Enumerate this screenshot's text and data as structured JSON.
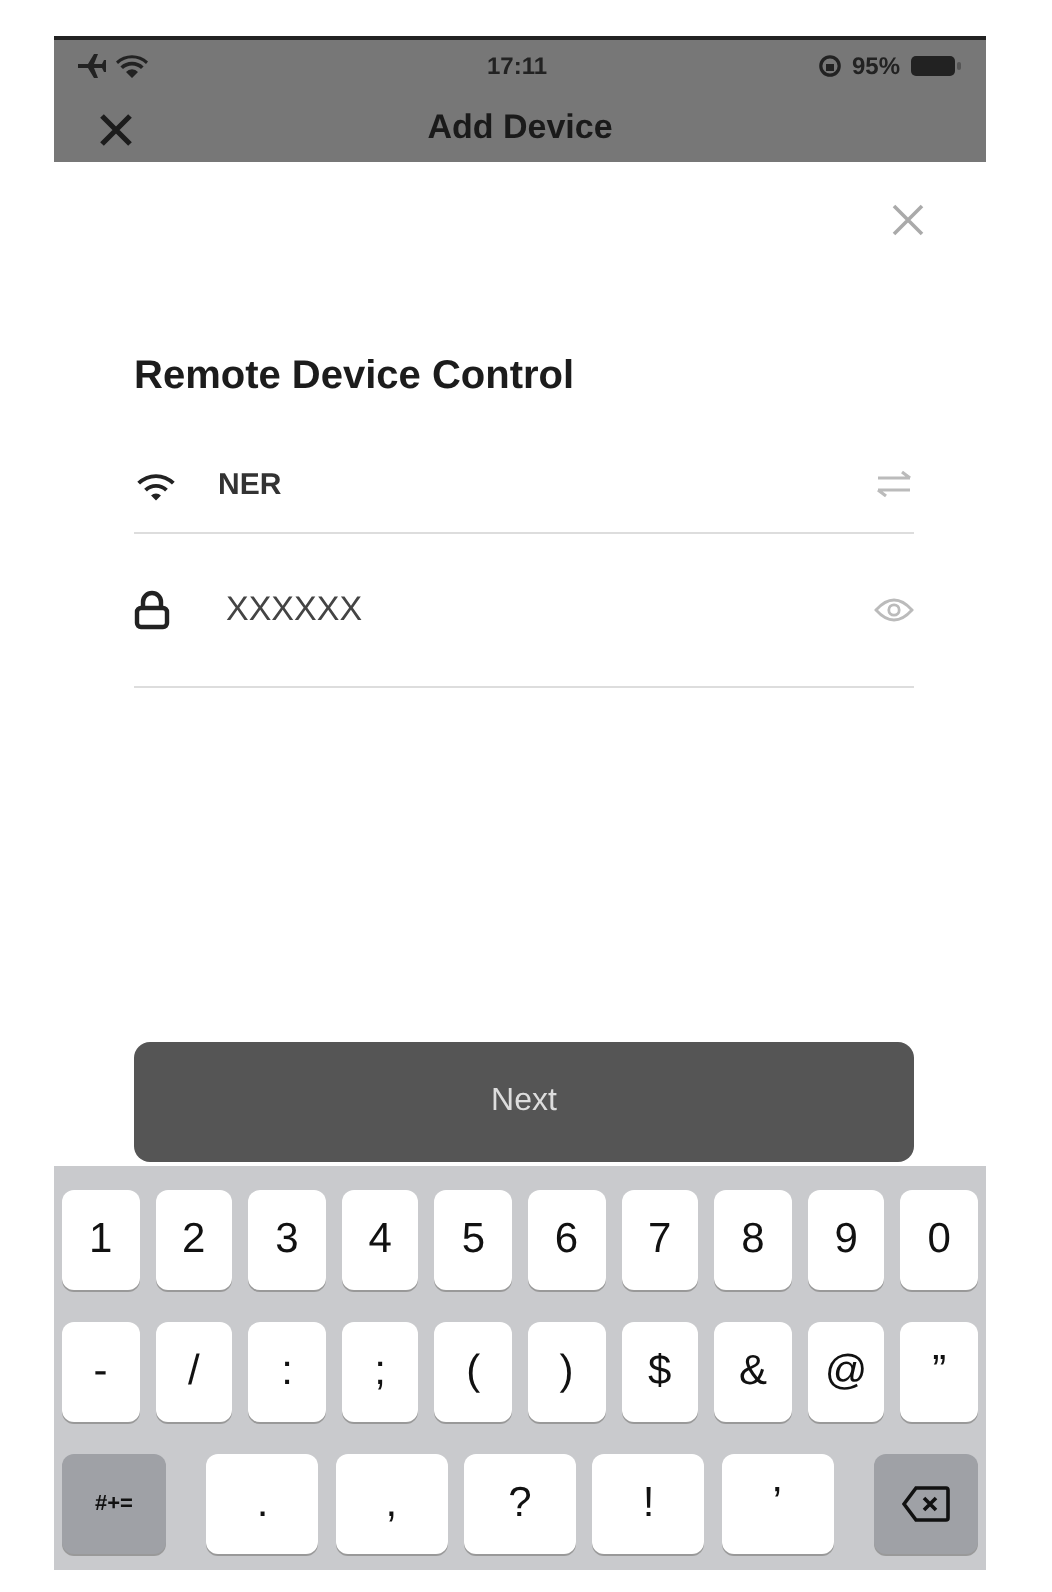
{
  "status_bar": {
    "time": "17:11",
    "battery_percent": "95%"
  },
  "nav_bar": {
    "title": "Add Device"
  },
  "sheet": {
    "title": "Remote Device Control",
    "wifi_name": "NER",
    "password": {
      "value": "XXXXXX"
    },
    "button": "Next"
  },
  "keyboard": {
    "rows": [
      [
        {
          "kind": "char",
          "label": "1"
        },
        {
          "kind": "char",
          "label": "2"
        },
        {
          "kind": "char",
          "label": "3"
        },
        {
          "kind": "char",
          "label": "4"
        },
        {
          "kind": "char",
          "label": "5"
        },
        {
          "kind": "char",
          "label": "6"
        },
        {
          "kind": "char",
          "label": "7"
        },
        {
          "kind": "char",
          "label": "8"
        },
        {
          "kind": "char",
          "label": "9"
        },
        {
          "kind": "char",
          "label": "0"
        }
      ],
      [
        {
          "kind": "char",
          "label": "-"
        },
        {
          "kind": "char",
          "label": "/"
        },
        {
          "kind": "char",
          "label": ":"
        },
        {
          "kind": "char",
          "label": ";"
        },
        {
          "kind": "char",
          "label": "("
        },
        {
          "kind": "char",
          "label": ")"
        },
        {
          "kind": "char",
          "label": "$"
        },
        {
          "kind": "char",
          "label": "&"
        },
        {
          "kind": "char",
          "label": "@"
        },
        {
          "kind": "char",
          "label": "”"
        }
      ],
      [
        {
          "kind": "mode",
          "label": "#+="
        },
        {
          "kind": "wide",
          "label": "."
        },
        {
          "kind": "wide",
          "label": ","
        },
        {
          "kind": "wide",
          "label": "?"
        },
        {
          "kind": "wide",
          "label": "!"
        },
        {
          "kind": "wide",
          "label": "’"
        },
        {
          "kind": "delete"
        }
      ]
    ]
  }
}
